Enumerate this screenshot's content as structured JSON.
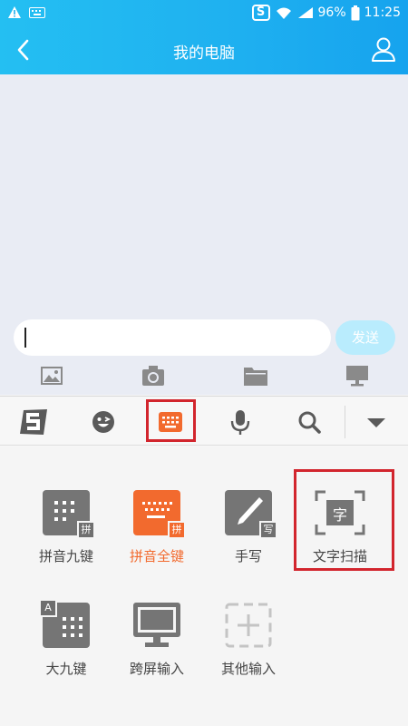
{
  "status_bar": {
    "battery": "96%",
    "time": "11:25"
  },
  "header": {
    "title": "我的电脑"
  },
  "chat": {
    "input_value": "",
    "send_label": "发送"
  },
  "chat_tools": [
    {
      "icon": "image-icon"
    },
    {
      "icon": "camera-icon"
    },
    {
      "icon": "folder-icon"
    },
    {
      "icon": "computer-icon"
    }
  ],
  "ime_toolbar": [
    {
      "icon": "sogou-logo-icon"
    },
    {
      "icon": "emoji-icon"
    },
    {
      "icon": "keyboard-icon",
      "highlighted": true
    },
    {
      "icon": "microphone-icon"
    },
    {
      "icon": "search-icon"
    },
    {
      "icon": "dropdown-arrow-icon"
    }
  ],
  "keyboard_options": {
    "row1": [
      {
        "label": "拼音九键",
        "badge": "拼"
      },
      {
        "label": "拼音全键",
        "badge": "拼",
        "active": true
      },
      {
        "label": "手写",
        "badge": "写"
      },
      {
        "label": "文字扫描",
        "glyph": "字",
        "highlighted": true
      }
    ],
    "row2": [
      {
        "label": "大九键",
        "badge": "A"
      },
      {
        "label": "跨屏输入"
      },
      {
        "label": "其他输入"
      }
    ]
  },
  "colors": {
    "header_gradient_start": "#24bff2",
    "header_gradient_end": "#16a3ee",
    "accent_orange": "#f26a2e",
    "highlight_red": "#d2252d",
    "tile_gray": "#757575",
    "send_button": "#b9ecfd"
  }
}
